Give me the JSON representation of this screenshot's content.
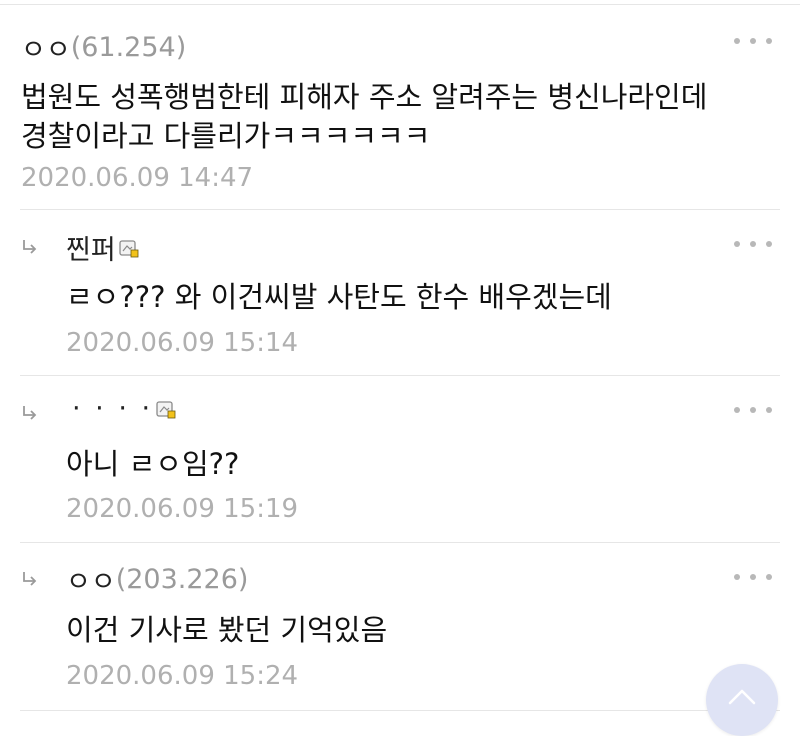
{
  "comments": [
    {
      "author": "ㅇㅇ",
      "ip": "(61.254)",
      "lines": [
        "법원도 성폭행범한테 피해자 주소 알려주는 병신나라인데",
        "경찰이라고 다를리가ㅋㅋㅋㅋㅋㅋ"
      ],
      "date": "2020.06.09 14:47"
    },
    {
      "author": "찐퍼",
      "text": "ㄹㅇ??? 와 이건씨발 사탄도 한수 배우겠는데",
      "date": "2020.06.09 15:14"
    },
    {
      "author": "· · · ·",
      "text": "아니 ㄹㅇ임??",
      "date": "2020.06.09 15:19"
    },
    {
      "author": "ㅇㅇ",
      "ip": "(203.226)",
      "text": "이건 기사로 봤던 기억있음",
      "date": "2020.06.09 15:24"
    }
  ],
  "icons": {
    "more": "more-dots-icon",
    "reply": "reply-arrow-icon",
    "member": "member-badge-icon",
    "scroll_top": "chevron-up-icon"
  },
  "colors": {
    "text": "#111111",
    "meta": "#b0b0b0",
    "ip": "#9a9a9a",
    "scroll_button": "#dfe3f5"
  }
}
